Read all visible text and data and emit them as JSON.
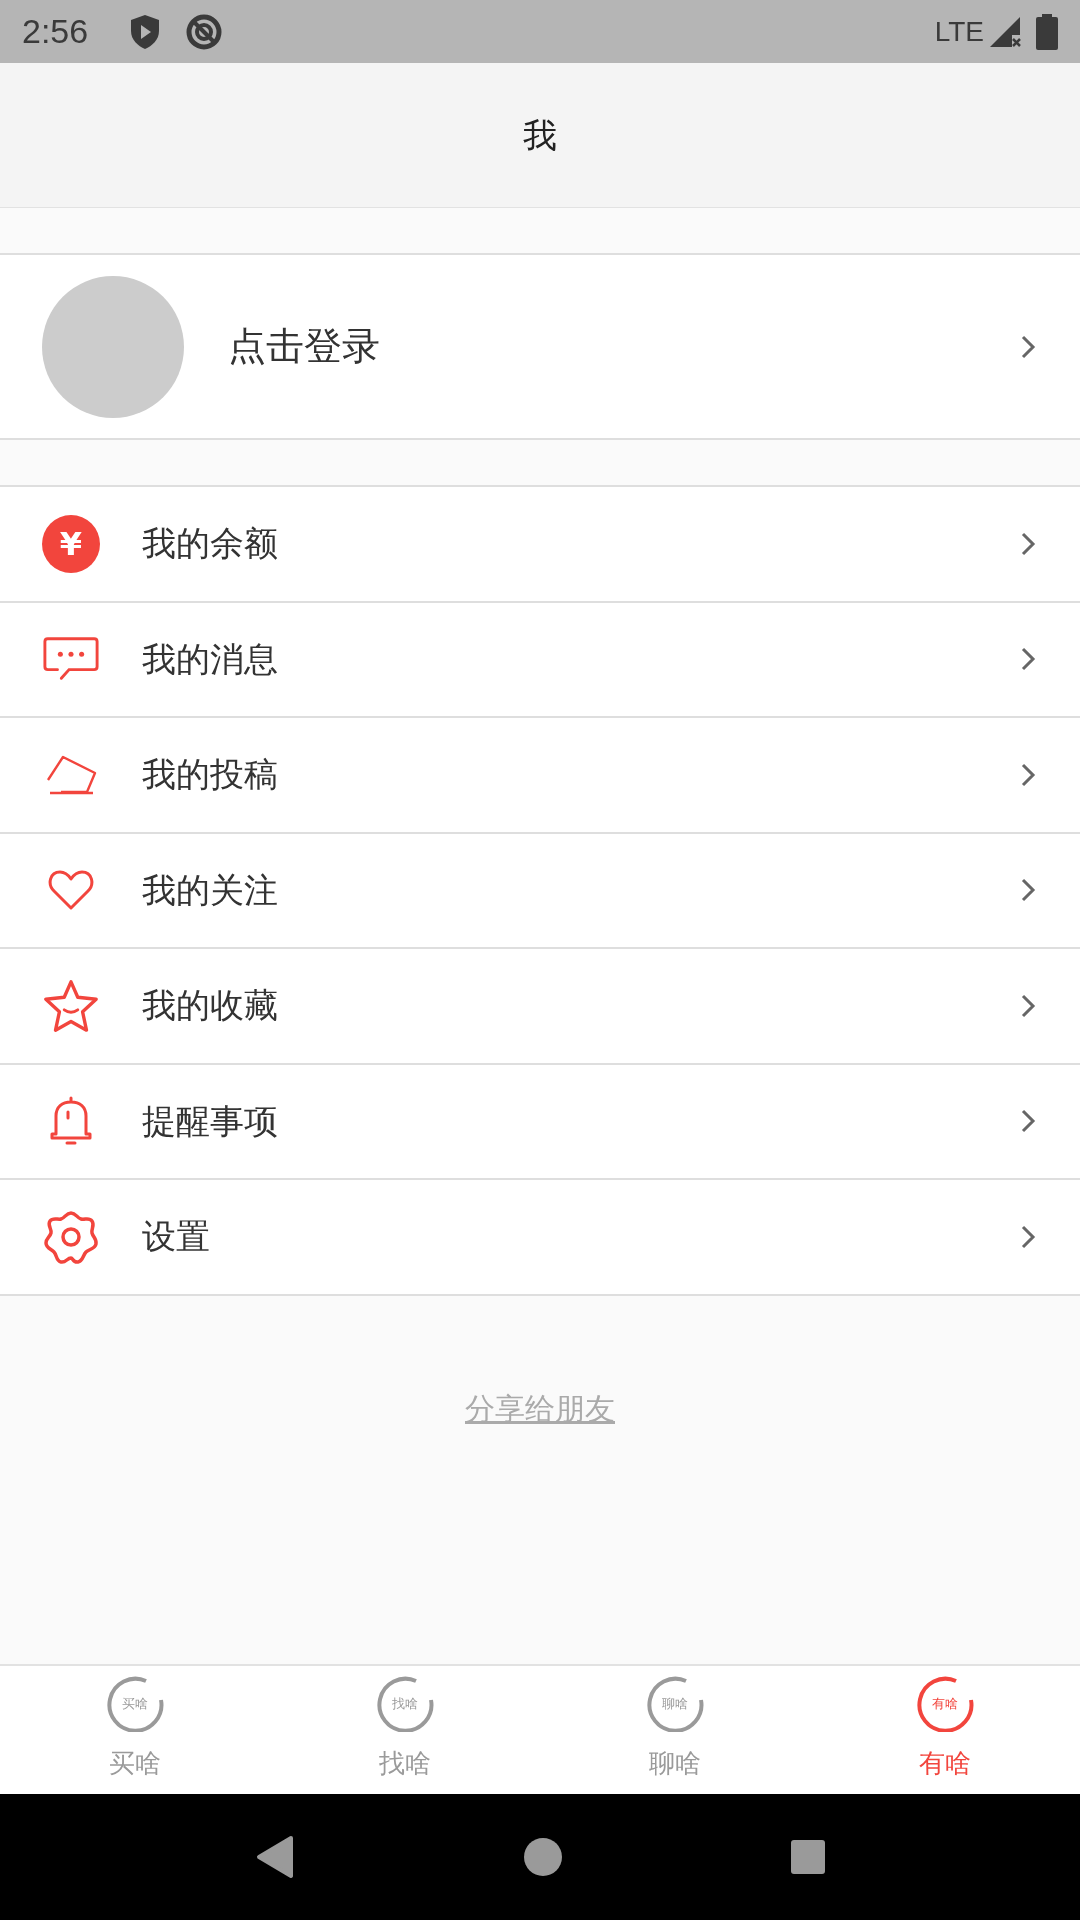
{
  "status_bar": {
    "time": "2:56",
    "network": "LTE"
  },
  "header": {
    "title": "我"
  },
  "profile": {
    "label": "点击登录"
  },
  "menu": [
    {
      "kind": "balance",
      "label": "我的余额",
      "icon_text": "¥"
    },
    {
      "kind": "messages",
      "label": "我的消息"
    },
    {
      "kind": "posts",
      "label": "我的投稿"
    },
    {
      "kind": "follows",
      "label": "我的关注"
    },
    {
      "kind": "favorites",
      "label": "我的收藏"
    },
    {
      "kind": "reminders",
      "label": "提醒事项"
    },
    {
      "kind": "settings",
      "label": "设置"
    }
  ],
  "share_link": "分享给朋友",
  "tabs": [
    {
      "label": "买啥",
      "icon_text": "买啥",
      "selected": false
    },
    {
      "label": "找啥",
      "icon_text": "找啥",
      "selected": false
    },
    {
      "label": "聊啥",
      "icon_text": "聊啥",
      "selected": false
    },
    {
      "label": "有啥",
      "icon_text": "有啥",
      "selected": true
    }
  ]
}
